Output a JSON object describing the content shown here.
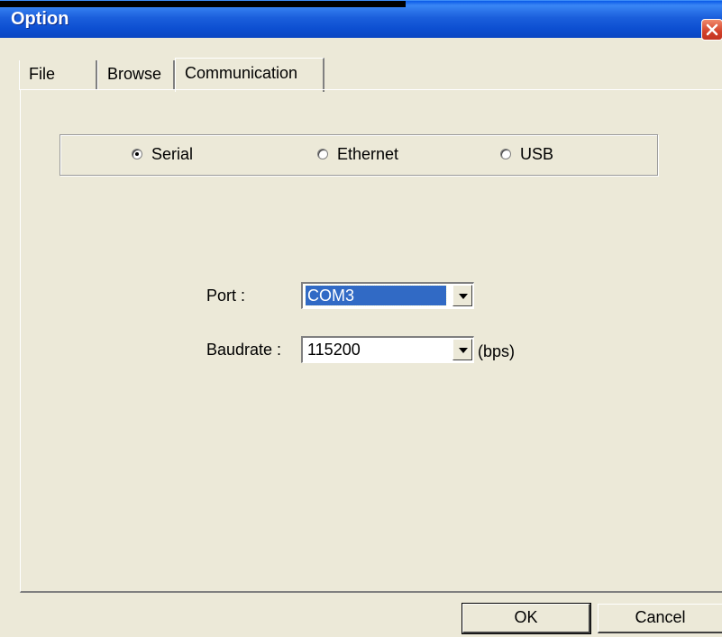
{
  "window": {
    "title": "Option"
  },
  "tabs": [
    {
      "label": "File"
    },
    {
      "label": "Browse"
    },
    {
      "label": "Communication",
      "active": true
    }
  ],
  "connection": {
    "options": [
      {
        "label": "Serial",
        "selected": true
      },
      {
        "label": "Ethernet",
        "selected": false
      },
      {
        "label": "USB",
        "selected": false
      }
    ]
  },
  "port": {
    "label": "Port :",
    "value": "COM3"
  },
  "baudrate": {
    "label": "Baudrate :",
    "value": "115200",
    "unit": "(bps)"
  },
  "buttons": {
    "ok": "OK",
    "cancel": "Cancel"
  },
  "colors": {
    "titlebar": "#0d4fd1",
    "dialog_bg": "#ece9d8",
    "selection": "#316ac5",
    "close": "#d2412a"
  }
}
